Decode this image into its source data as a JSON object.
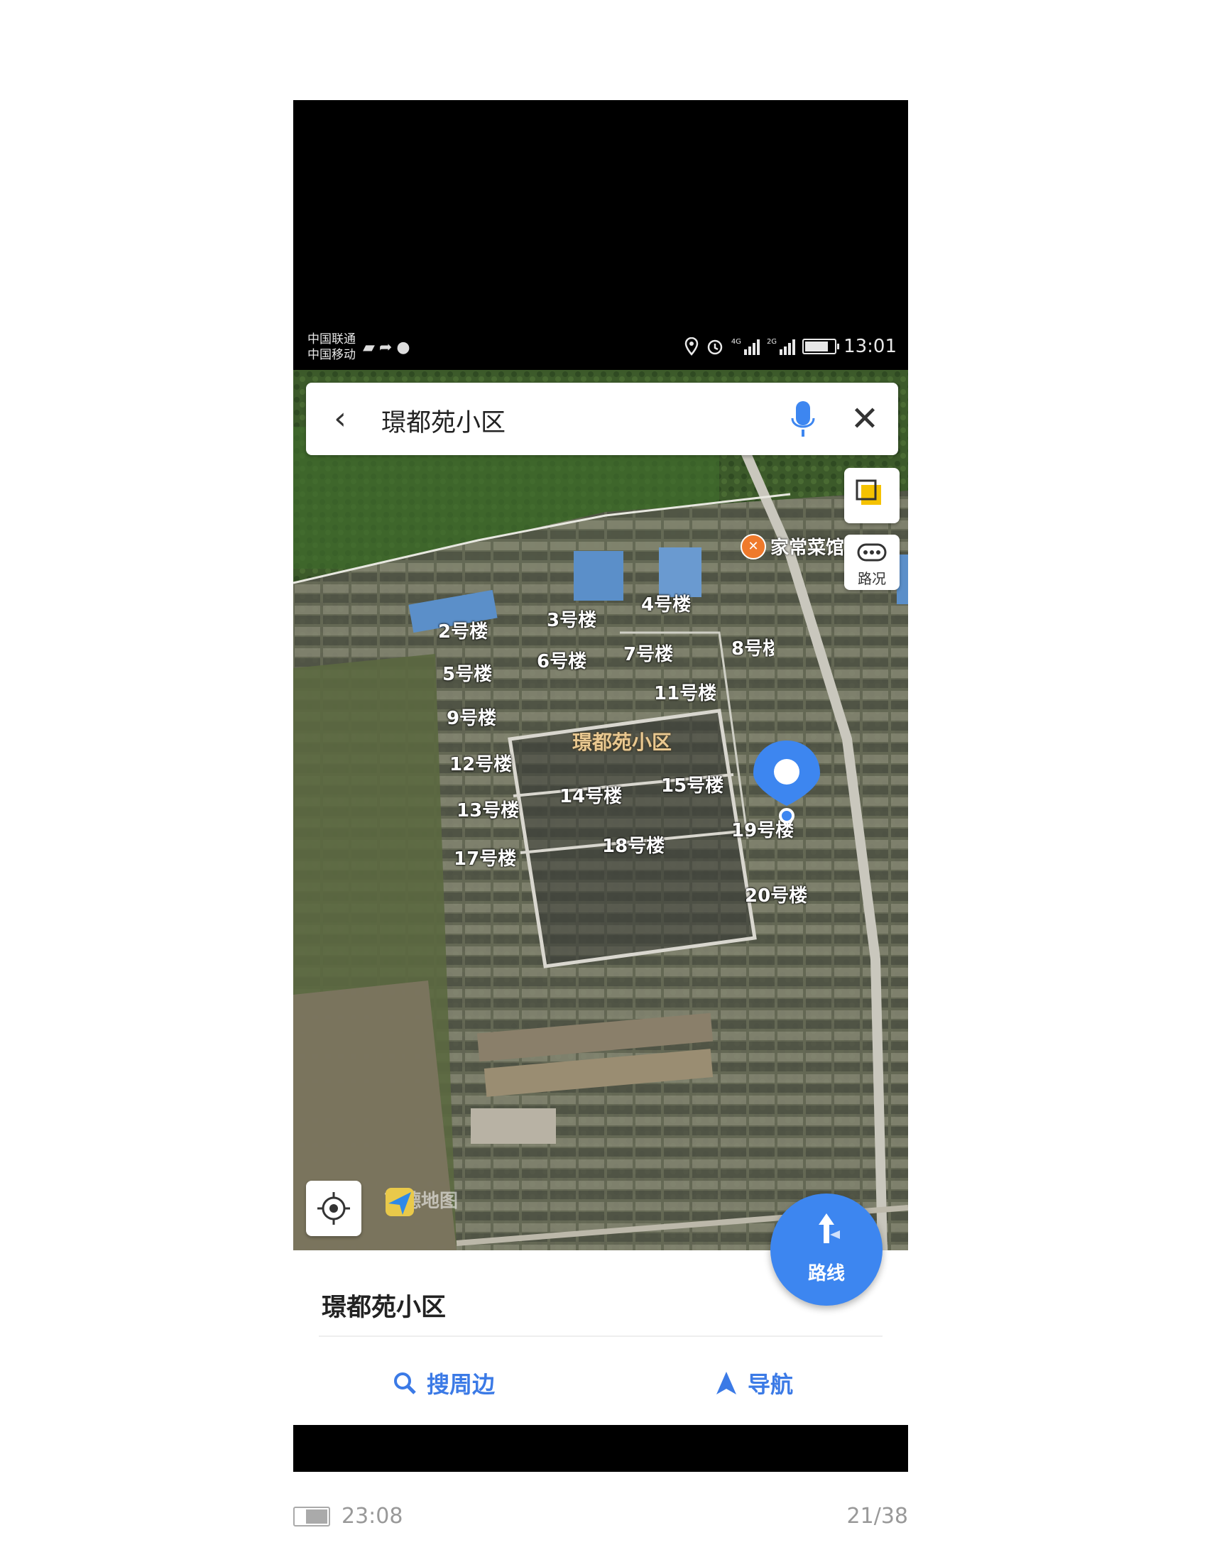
{
  "status_bar": {
    "carrier_1": "中国联通",
    "carrier_2": "中国移动",
    "net_4g": "4G",
    "net_2g": "2G",
    "time": "13:01"
  },
  "search": {
    "query": "璟都苑小区"
  },
  "map": {
    "traffic_label": "路况",
    "poi_restaurant": "家常菜馆",
    "area_name": "璟都苑小区",
    "logo_text": "高德地图",
    "buildings": [
      "2号楼",
      "3号楼",
      "4号楼",
      "5号楼",
      "6号楼",
      "7号楼",
      "8号楼",
      "9号楼",
      "11号楼",
      "12号楼",
      "13号楼",
      "14号楼",
      "15号楼",
      "17号楼",
      "18号楼",
      "19号楼",
      "20号楼"
    ]
  },
  "sheet": {
    "place_title": "璟都苑小区",
    "route_label": "路线",
    "search_nearby": "搜周边",
    "navigate": "导航"
  },
  "viewer": {
    "time": "23:08",
    "page": "21/38"
  },
  "colors": {
    "accent": "#3d86f0",
    "poi": "#ef7a2c"
  }
}
